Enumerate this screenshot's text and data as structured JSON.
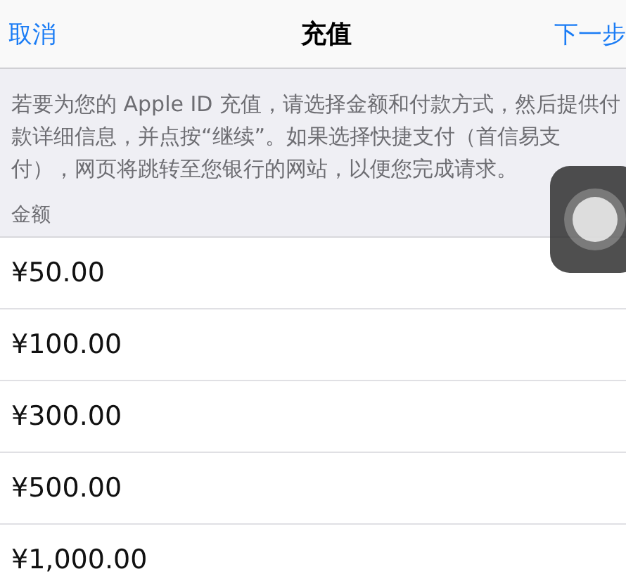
{
  "nav": {
    "cancel": "取消",
    "title": "充值",
    "next": "下一步"
  },
  "description": "若要为您的 Apple ID 充值，请选择金额和付款方式，然后提供付款详细信息，并点按“继续”。如果选择快捷支付（首信易支付），网页将跳转至您银行的网站，以便您完成请求。",
  "section_header": "金额",
  "amounts": [
    "¥50.00",
    "¥100.00",
    "¥300.00",
    "¥500.00",
    "¥1,000.00"
  ]
}
